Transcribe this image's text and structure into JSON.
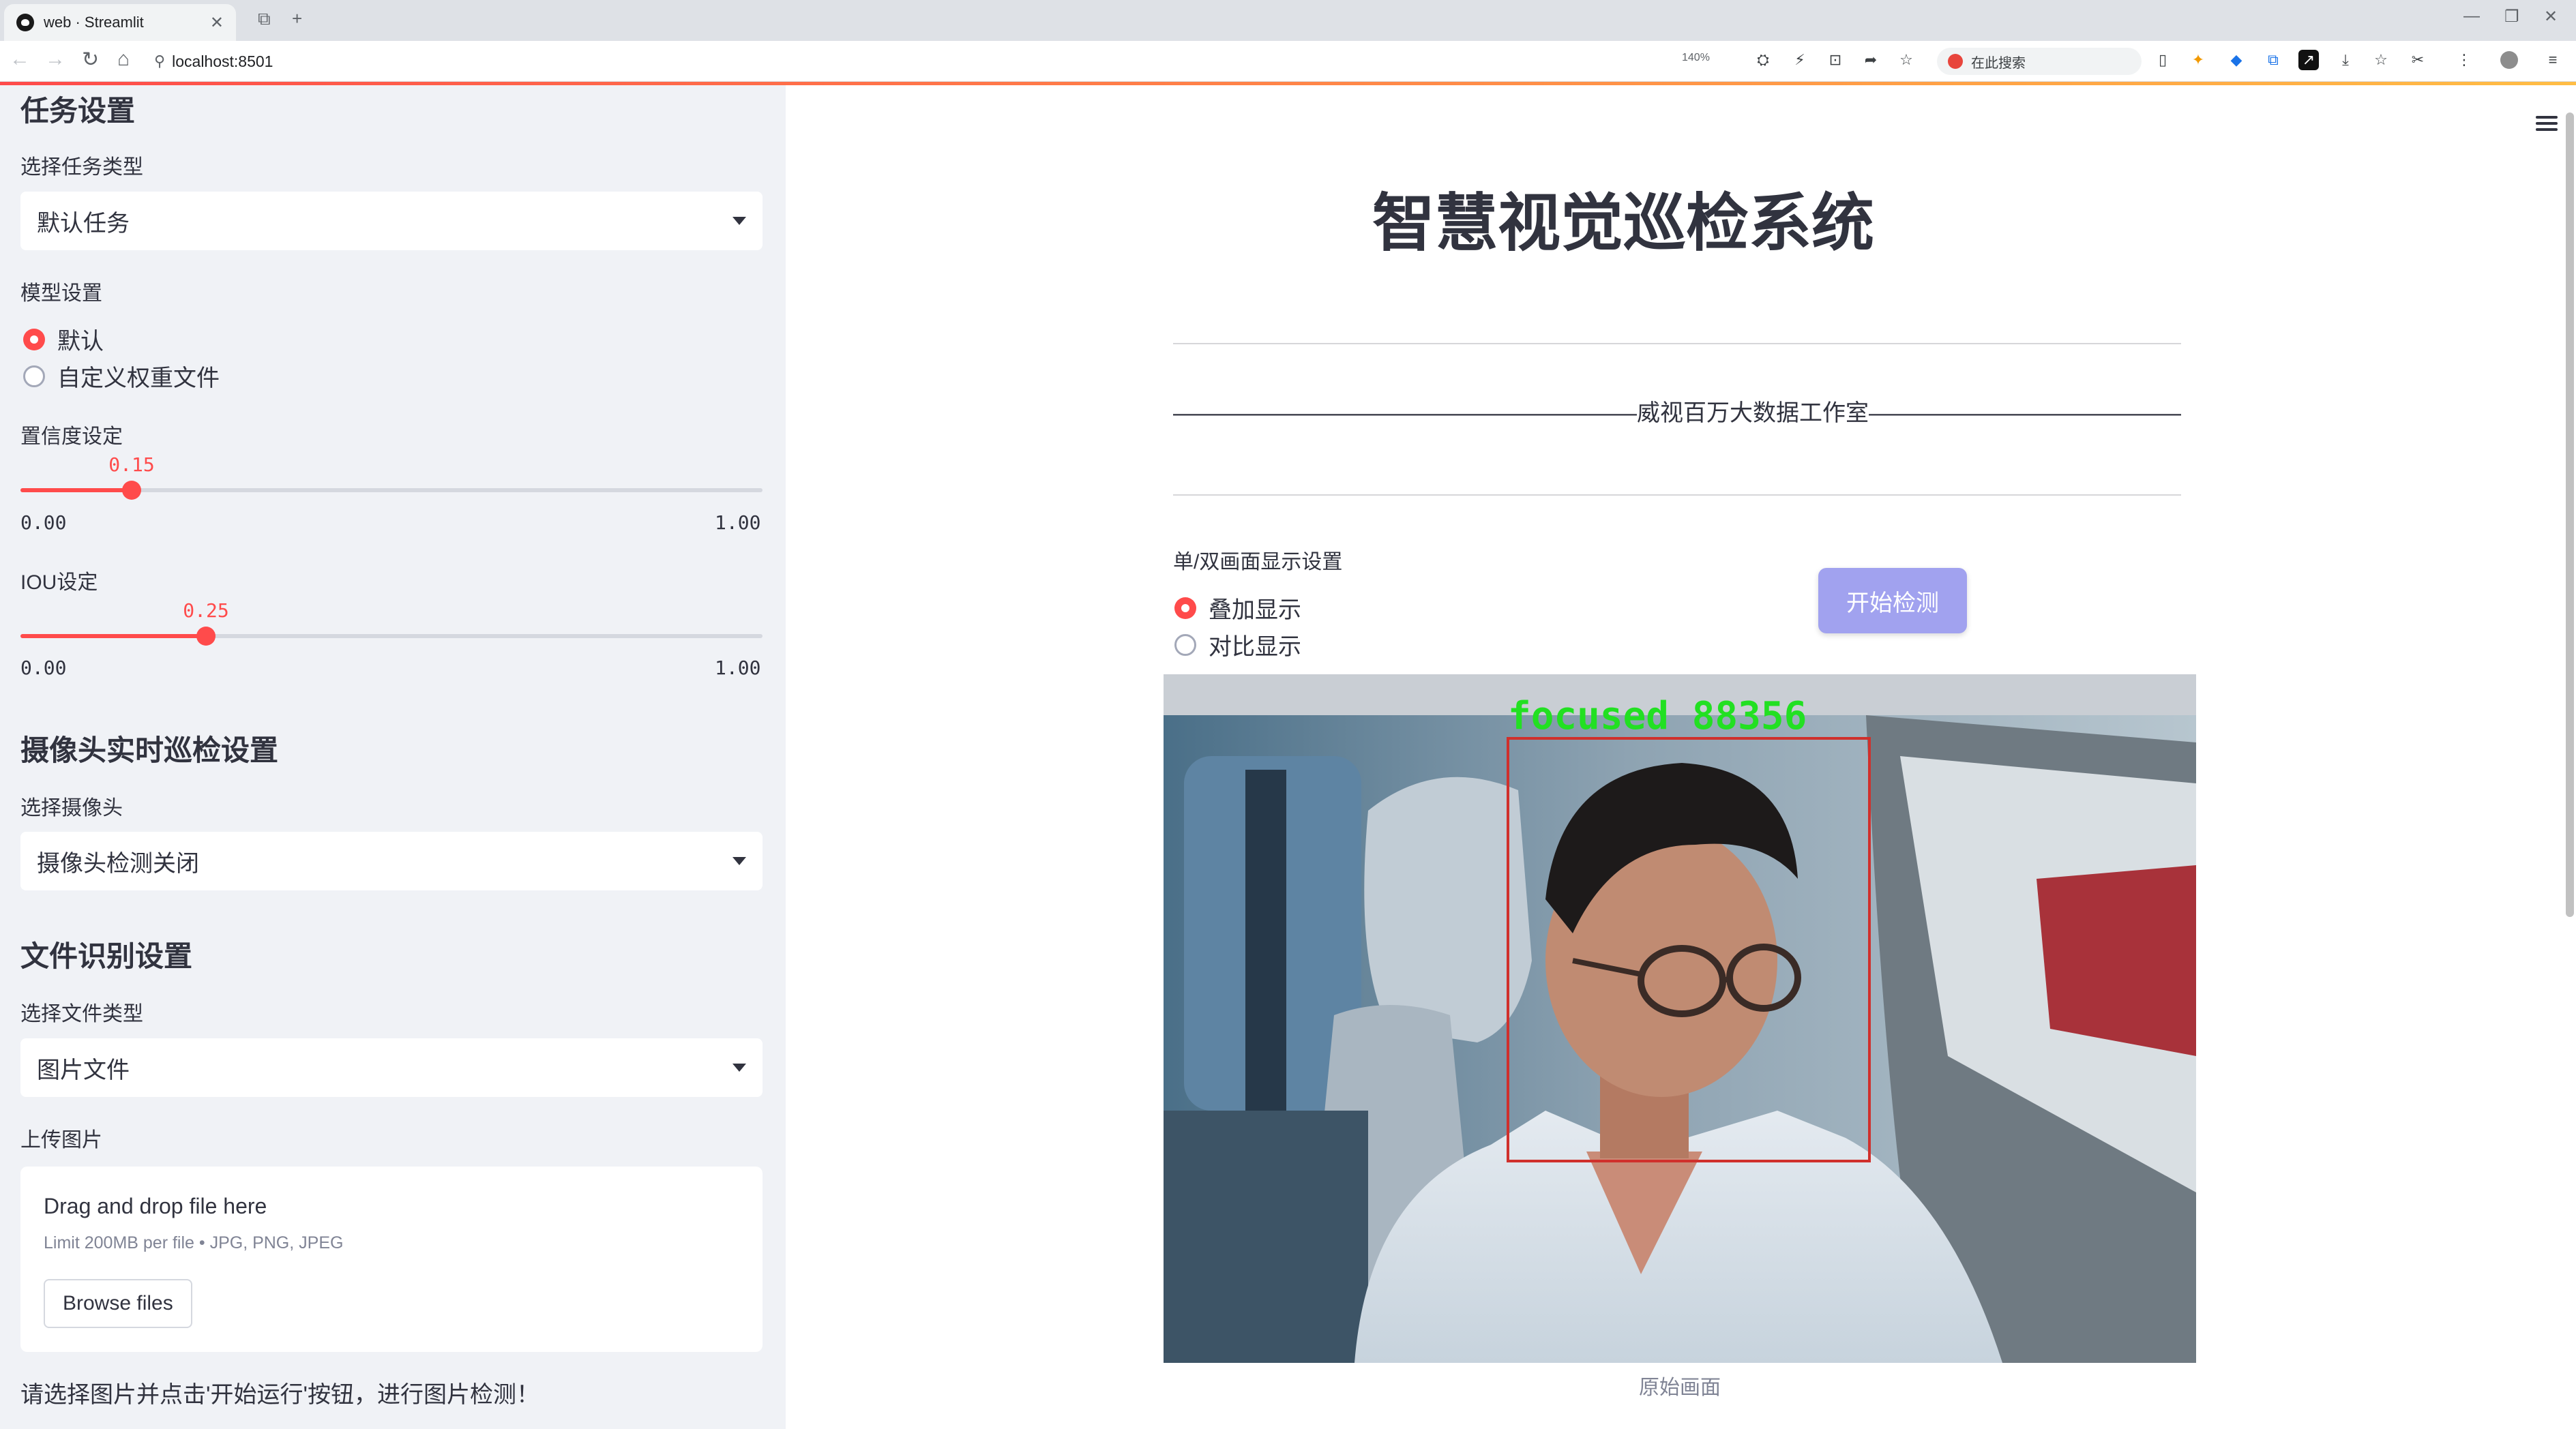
{
  "browser": {
    "tab_title": "web · Streamlit",
    "url": "localhost:8501",
    "zoom": "140%",
    "search_placeholder": "在此搜索"
  },
  "sidebar": {
    "task_header": "任务设置",
    "task_type_label": "选择任务类型",
    "task_type_value": "默认任务",
    "model_label": "模型设置",
    "model_options": [
      "默认",
      "自定义权重文件"
    ],
    "model_selected": "默认",
    "conf_label": "置信度设定",
    "conf_value": "0.15",
    "conf_min": "0.00",
    "conf_max": "1.00",
    "iou_label": "IOU设定",
    "iou_value": "0.25",
    "iou_min": "0.00",
    "iou_max": "1.00",
    "camera_header": "摄像头实时巡检设置",
    "camera_label": "选择摄像头",
    "camera_value": "摄像头检测关闭",
    "file_header": "文件识别设置",
    "file_type_label": "选择文件类型",
    "file_type_value": "图片文件",
    "upload_label": "上传图片",
    "upload_title": "Drag and drop file here",
    "upload_limit": "Limit 200MB per file • JPG, PNG, JPEG",
    "browse_label": "Browse files",
    "hint": "请选择图片并点击'开始运行'按钮，进行图片检测！"
  },
  "main": {
    "title": "智慧视觉巡检系统",
    "subtitle": "————————————————————威视百万大数据工作室—————————————————————",
    "display_label": "单/双画面显示设置",
    "display_options": [
      "叠加显示",
      "对比显示"
    ],
    "display_selected": "叠加显示",
    "start_button": "开始检测",
    "detection_label": "focused  88356",
    "image_caption": "原始画面"
  },
  "colors": {
    "accent": "#ff4b4b",
    "sidebar_bg": "#f0f2f6",
    "button": "#a1a2ef",
    "detect_box": "#d0302c",
    "detect_text": "#22e022"
  }
}
